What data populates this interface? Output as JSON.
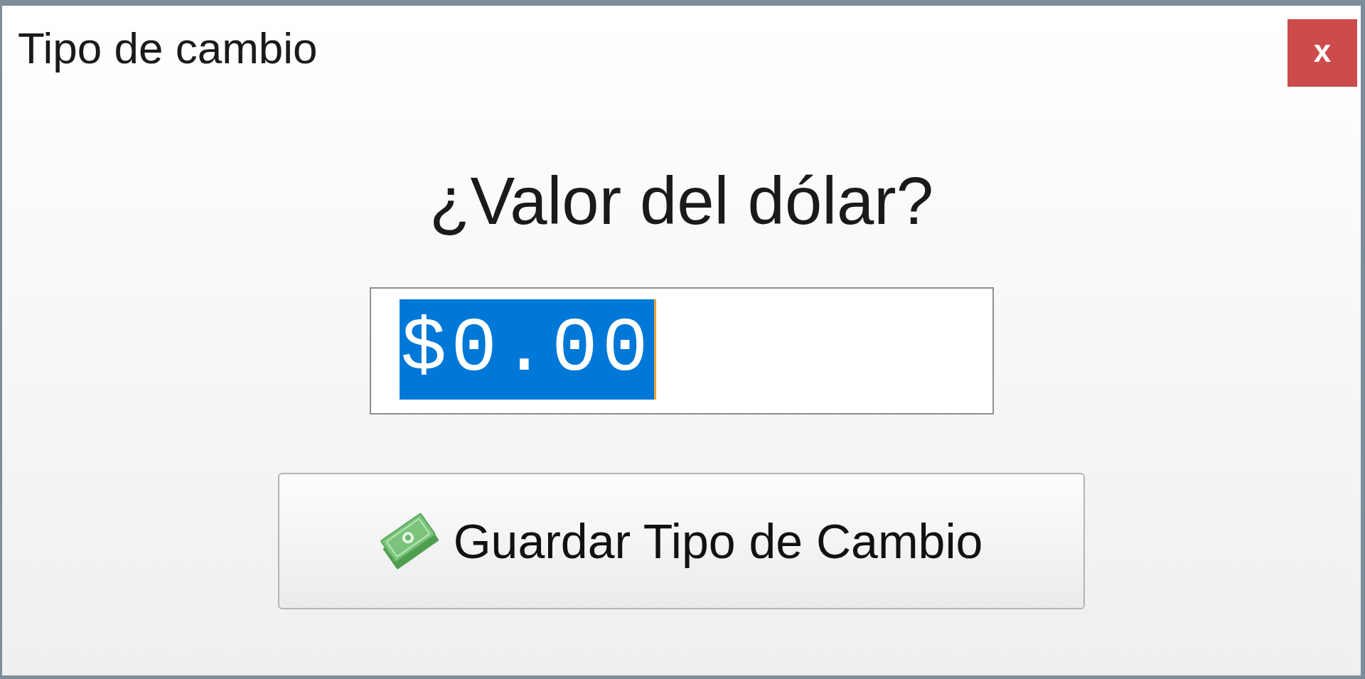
{
  "window": {
    "title": "Tipo de cambio",
    "close_button": "x"
  },
  "prompt": "¿Valor del dólar?",
  "amount_field": {
    "value": "$0.00",
    "text_selected": true
  },
  "save_button": {
    "label": "Guardar Tipo de Cambio"
  }
}
